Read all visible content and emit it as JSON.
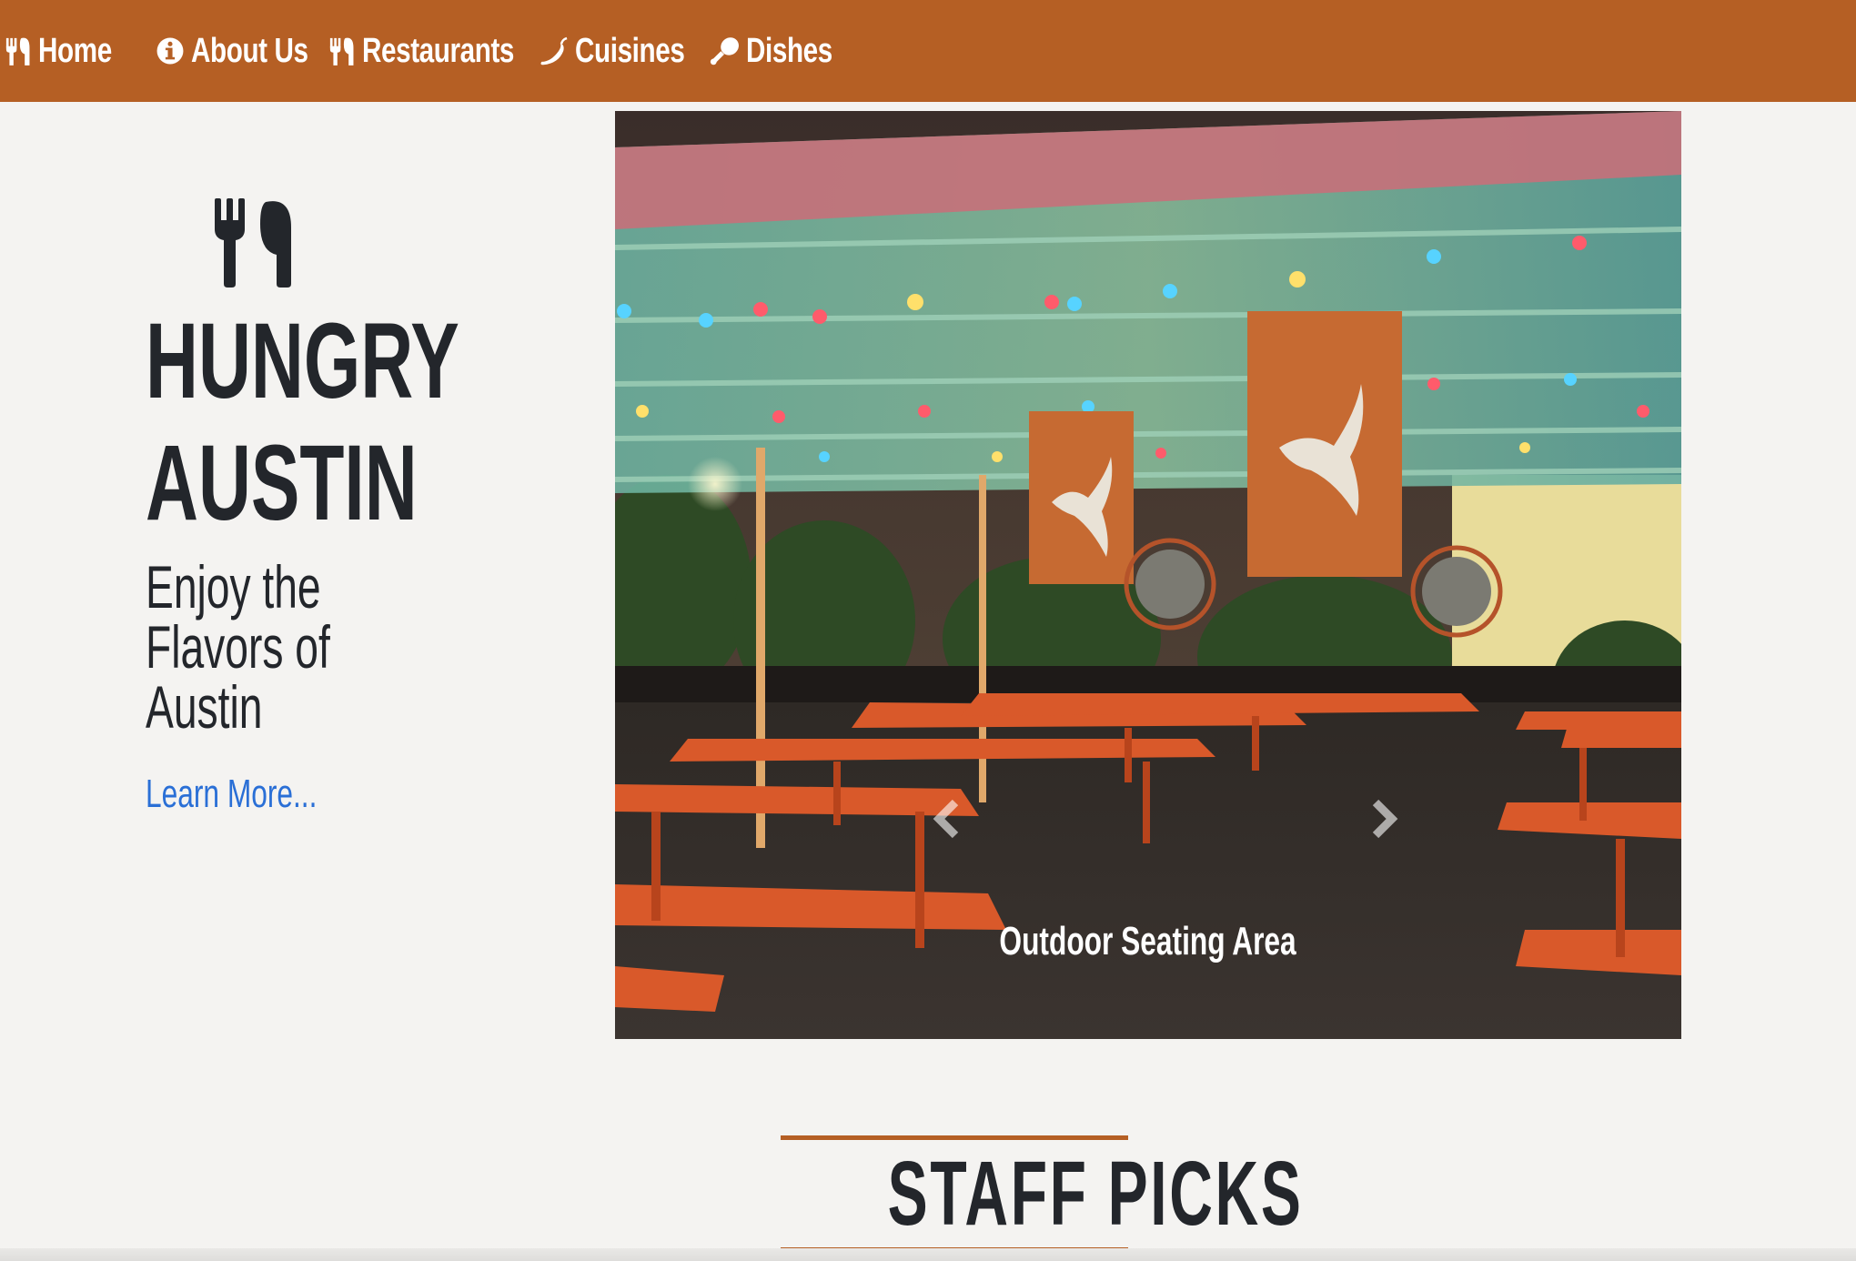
{
  "nav": {
    "items": [
      {
        "label": "Home",
        "icon": "utensils-icon"
      },
      {
        "label": "About Us",
        "icon": "info-circle-icon"
      },
      {
        "label": "Restaurants",
        "icon": "utensils-icon"
      },
      {
        "label": "Cuisines",
        "icon": "pepper-icon"
      },
      {
        "label": "Dishes",
        "icon": "drumstick-icon"
      }
    ]
  },
  "hero": {
    "brand_line1": "HUNGRY",
    "brand_line2": "AUSTIN",
    "tagline_lines": [
      "Enjoy the",
      "Flavors of",
      "Austin"
    ],
    "learn_more": "Learn More..."
  },
  "carousel": {
    "caption": "Outdoor Seating Area",
    "prev_icon": "chevron-left-icon",
    "next_icon": "chevron-right-icon"
  },
  "staff_picks": {
    "heading": "STAFF PICKS"
  },
  "colors": {
    "nav_bg": "#b55f24",
    "text_dark": "#23262b",
    "link_blue": "#2a6fd6",
    "page_bg": "#f4f3f1"
  }
}
